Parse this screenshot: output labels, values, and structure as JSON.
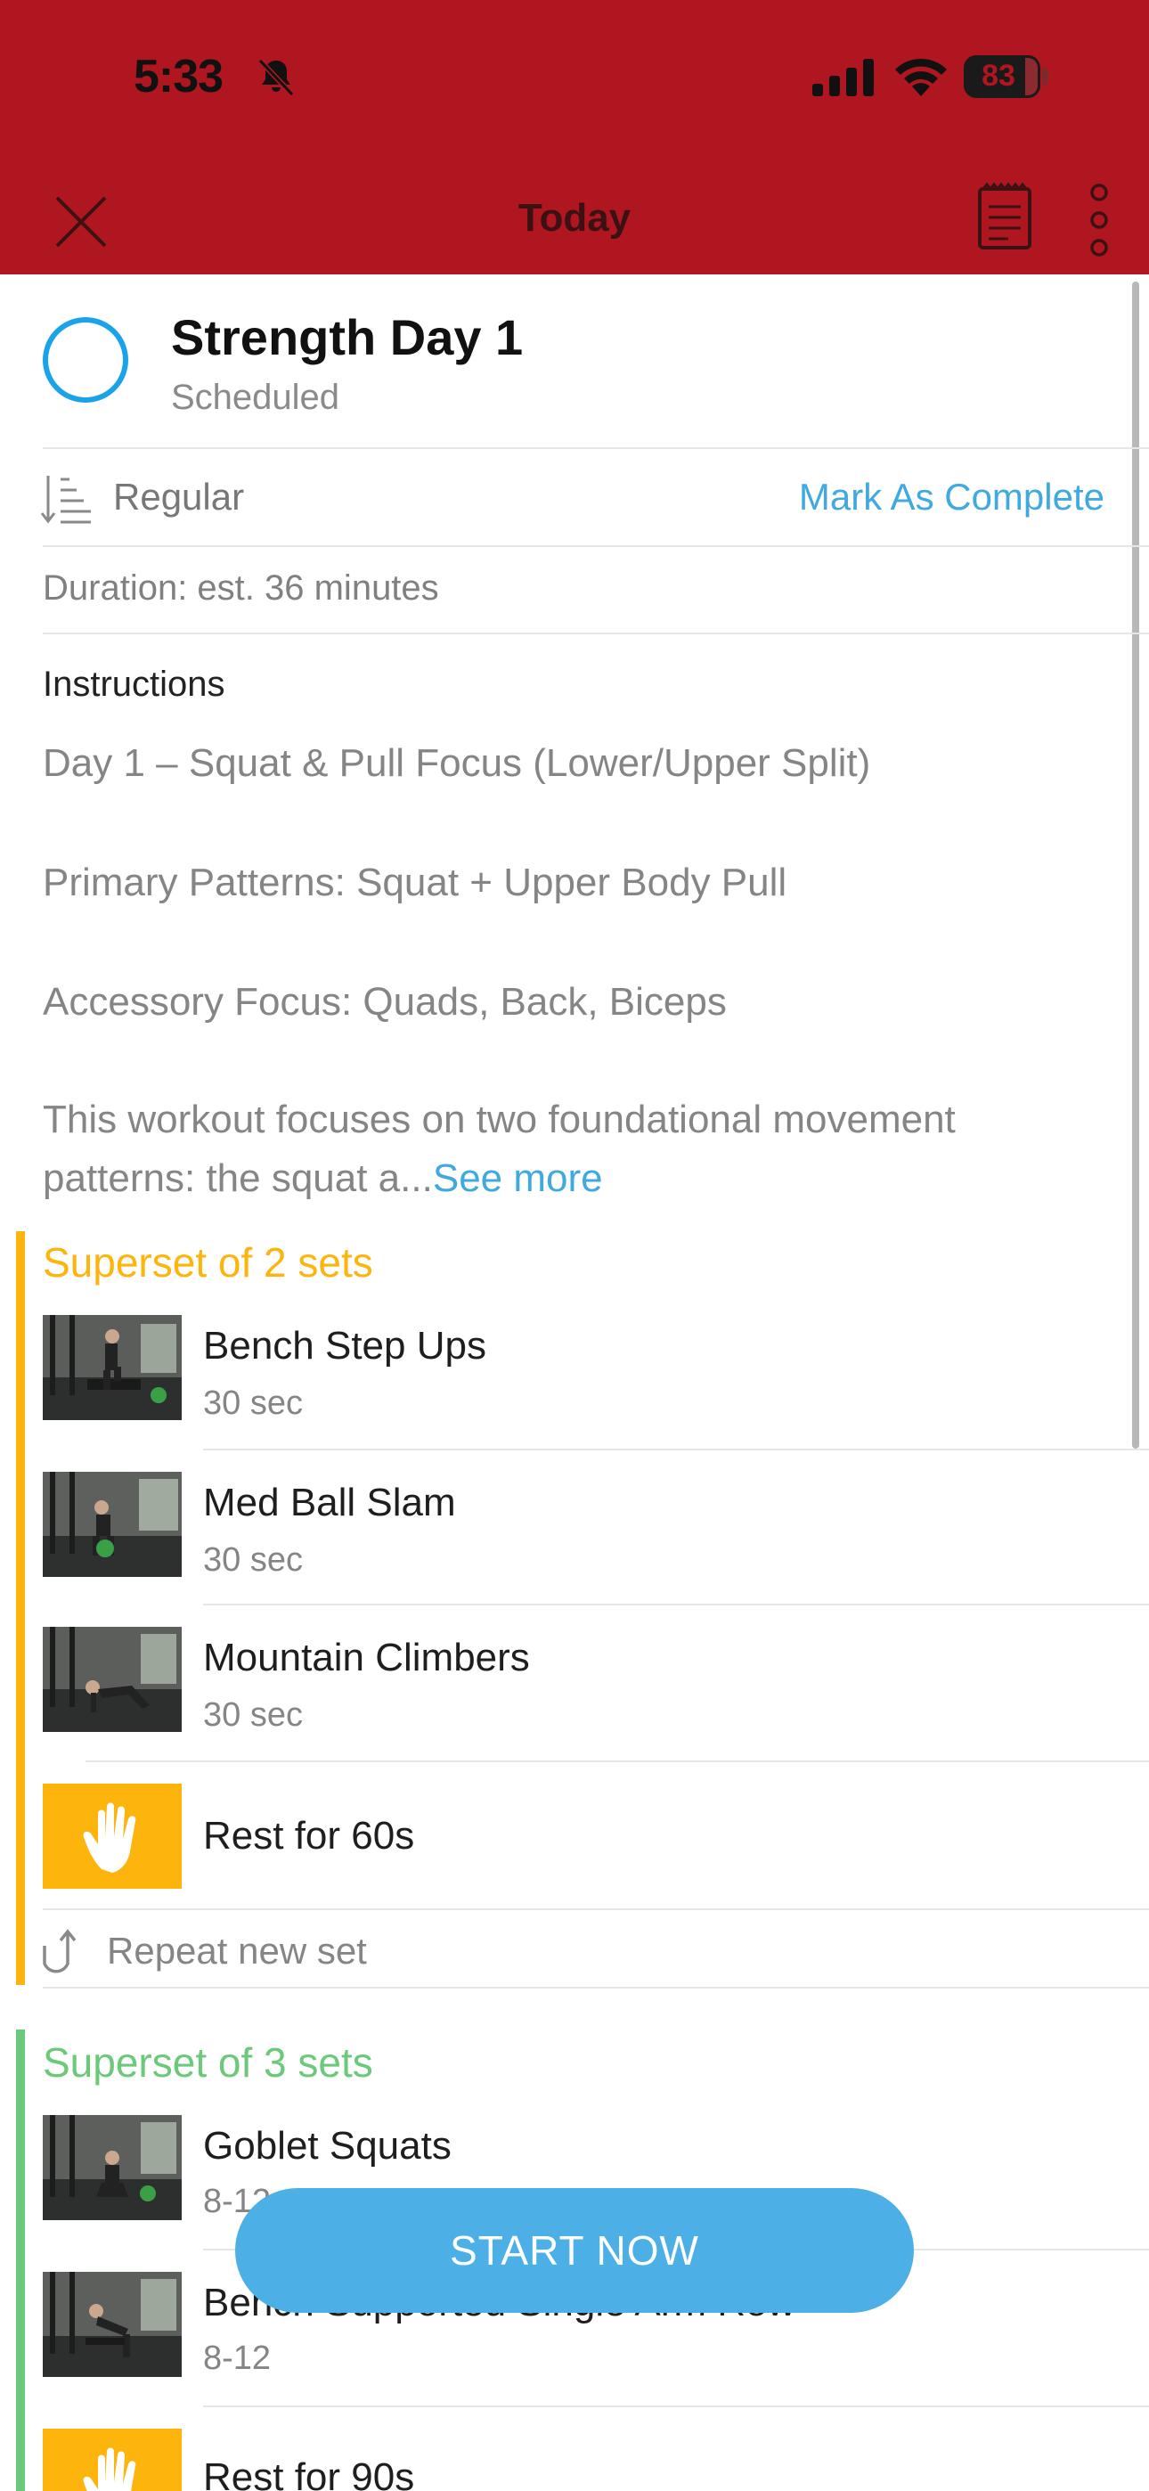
{
  "status_bar": {
    "time": "5:33",
    "battery": "83",
    "battery_level_percent": 83
  },
  "nav": {
    "title": "Today"
  },
  "workout": {
    "title": "Strength Day 1",
    "status": "Scheduled",
    "mode": "Regular",
    "mark_complete": "Mark As Complete",
    "duration": "Duration: est. 36 minutes"
  },
  "instructions": {
    "label": "Instructions",
    "line1": "Day 1 – Squat & Pull Focus (Lower/Upper Split)",
    "line2": "Primary Patterns: Squat + Upper Body Pull",
    "line3": "Accessory Focus: Quads, Back, Biceps",
    "line4": "This workout focuses on two foundational movement",
    "line5": "patterns: the squat a...",
    "see_more": "See more"
  },
  "superset1": {
    "title": "Superset of 2 sets",
    "color": "#fdb50d",
    "exercises": [
      {
        "name": "Bench Step Ups",
        "meta": "30 sec"
      },
      {
        "name": "Med Ball Slam",
        "meta": "30 sec"
      },
      {
        "name": "Mountain Climbers",
        "meta": "30 sec"
      }
    ],
    "rest": "Rest for 60s",
    "repeat": "Repeat new set"
  },
  "superset2": {
    "title": "Superset of 3 sets",
    "color": "#6cc97a",
    "exercises": [
      {
        "name": "Goblet Squats",
        "meta": "8-12"
      },
      {
        "name": "Bench Supported Single Arm Row",
        "meta": "8-12"
      }
    ],
    "rest": "Rest for 90s"
  },
  "actions": {
    "start": "START NOW"
  }
}
